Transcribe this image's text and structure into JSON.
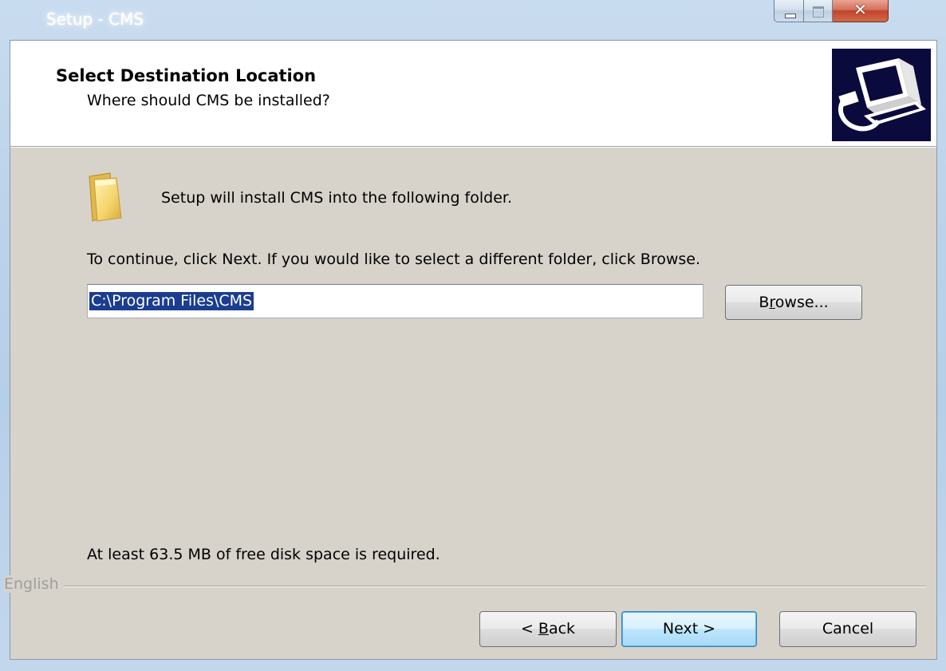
{
  "window": {
    "title": "Setup - CMS"
  },
  "header": {
    "title": "Select Destination Location",
    "subtitle": "Where should CMS be installed?"
  },
  "main": {
    "intro": "Setup will install CMS into the following folder.",
    "instruction": "To continue, click Next. If you would like to select a different folder, click Browse.",
    "path_value": "C:\\Program Files\\CMS",
    "browse_pre": "B",
    "browse_accel": "r",
    "browse_post": "owse...",
    "disk_space": "At least 63.5 MB of free disk space is required."
  },
  "footer": {
    "language": "English",
    "back_pre": "< ",
    "back_accel": "B",
    "back_post": "ack",
    "next_label": "Next >",
    "cancel_label": "Cancel"
  },
  "icons": {
    "folder": "folder-icon",
    "wizard": "computer-install-icon",
    "minimize": "minimize-icon",
    "maximize": "maximize-icon",
    "close": "close-icon"
  },
  "colors": {
    "client_bg": "#d7d3cb",
    "selection": "#1b3d8f",
    "wizard_bg": "#0a0a3c",
    "close_red": "#c0452b"
  }
}
